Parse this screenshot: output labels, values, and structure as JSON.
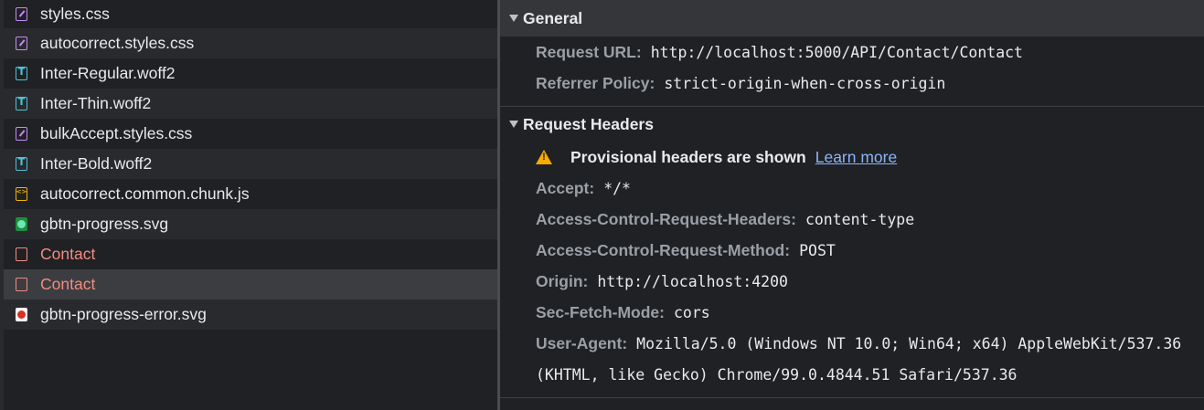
{
  "requests": [
    {
      "name": "styles.css",
      "icon": "css-file-icon"
    },
    {
      "name": "autocorrect.styles.css",
      "icon": "css-file-icon"
    },
    {
      "name": "Inter-Regular.woff2",
      "icon": "font-file-icon"
    },
    {
      "name": "Inter-Thin.woff2",
      "icon": "font-file-icon"
    },
    {
      "name": "bulkAccept.styles.css",
      "icon": "css-file-icon"
    },
    {
      "name": "Inter-Bold.woff2",
      "icon": "font-file-icon"
    },
    {
      "name": "autocorrect.common.chunk.js",
      "icon": "js-file-icon"
    },
    {
      "name": "gbtn-progress.svg",
      "icon": "svg-image-icon"
    },
    {
      "name": "Contact",
      "icon": "document-error-icon"
    },
    {
      "name": "Contact",
      "icon": "document-error-icon"
    },
    {
      "name": "gbtn-progress-error.svg",
      "icon": "svg-error-image-icon"
    }
  ],
  "general": {
    "title": "General",
    "request_url_label": "Request URL:",
    "request_url": "http://localhost:5000/API/Contact/Contact",
    "referrer_policy_label": "Referrer Policy:",
    "referrer_policy": "strict-origin-when-cross-origin"
  },
  "request_headers": {
    "title": "Request Headers",
    "warning": "Provisional headers are shown",
    "learn_more": "Learn more",
    "accept_label": "Accept:",
    "accept": "*/*",
    "acrh_label": "Access-Control-Request-Headers:",
    "acrh": "content-type",
    "acrm_label": "Access-Control-Request-Method:",
    "acrm": "POST",
    "origin_label": "Origin:",
    "origin": "http://localhost:4200",
    "sfm_label": "Sec-Fetch-Mode:",
    "sfm": "cors",
    "ua_label": "User-Agent:",
    "ua_line1": "Mozilla/5.0 (Windows NT 10.0; Win64; x64) AppleWebKit/537.36",
    "ua_line2": "(KHTML, like Gecko) Chrome/99.0.4844.51 Safari/537.36"
  },
  "colors": {
    "error_text": "#f28b82",
    "link": "#8ab4f8",
    "warning": "#f9ab00"
  }
}
